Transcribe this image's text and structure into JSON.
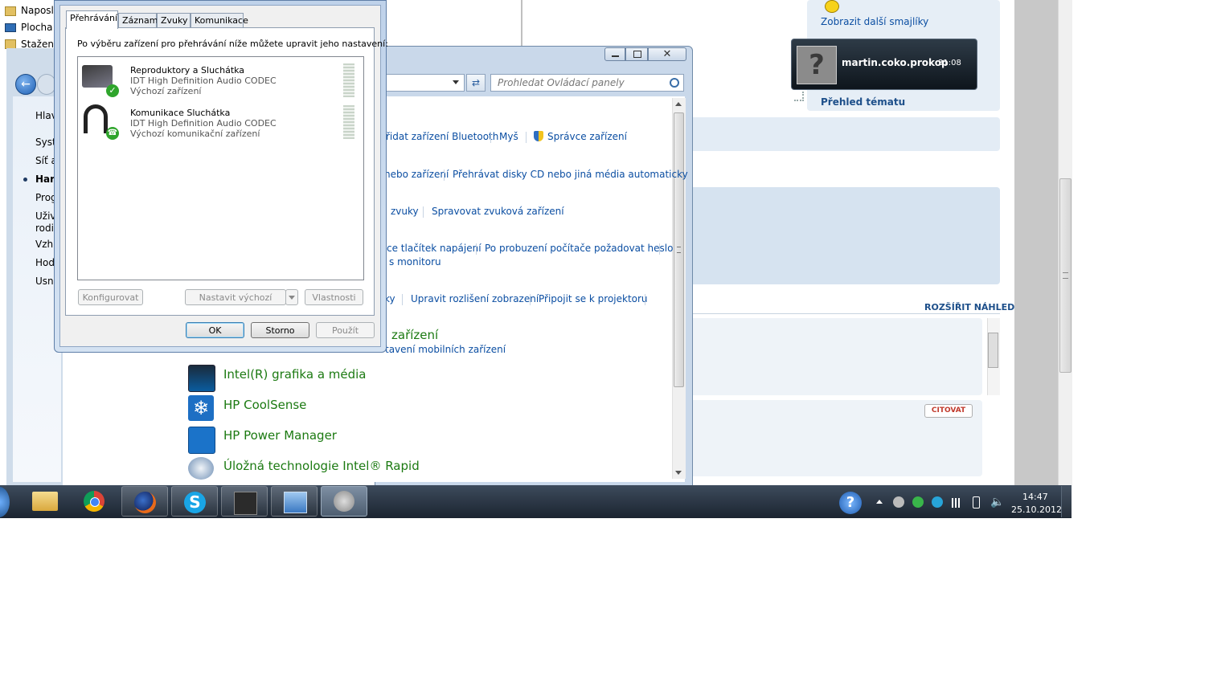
{
  "explorer": {
    "favorites": [
      "Naposle",
      "Plocha",
      "Stažené"
    ],
    "nav_items": [
      "Hlav",
      "Syst",
      "Síť a",
      "Hard",
      "Prog",
      "Uživ",
      "rodi",
      "Vzhl",
      "Hod",
      "Usna"
    ]
  },
  "browser": {
    "more_smileys": "Zobrazit další smajlíky",
    "overview": "Přehled tématu",
    "expand_preview": "ROZŠÍŘIT NÁHLED",
    "quote": "CITOVAT",
    "notification": {
      "user": "martin.coko.prokop",
      "time": "31:08"
    }
  },
  "control_panel": {
    "search_placeholder": "Prohledat Ovládací panely",
    "links": {
      "add_bluetooth": "řidat zařízení Bluetooth",
      "mouse": "Myš",
      "device_manager": "Správce zařízení",
      "device": "nebo zařízení",
      "autoplay": "Přehrávat disky CD nebo jiná média automaticky",
      "sounds": "zvuky",
      "manage_audio": "Spravovat zvuková zařízení",
      "power_buttons": "ce tlačítek napájení",
      "wake_password": "Po probuzení počítače požadovat heslo",
      "monitor": "s monitoru",
      "display_suffix": "ky",
      "resolution": "Upravit rozlišení zobrazení",
      "projector": "Připojit se k projektoru",
      "mobile_title": "zařízení",
      "mobile_settings": "tavení mobilních zařízení"
    },
    "items": [
      {
        "title": "Intel(R) grafika a média",
        "icon": "intel-graphics-icon"
      },
      {
        "title": "HP CoolSense",
        "icon": "snowflake-icon"
      },
      {
        "title": "HP Power Manager",
        "icon": "energy-star-icon"
      },
      {
        "title": "Úložná technologie Intel® Rapid",
        "icon": "storage-icon"
      }
    ]
  },
  "sound_dialog": {
    "tabs": [
      "Přehrávání",
      "Záznam",
      "Zvuky",
      "Komunikace"
    ],
    "instruction": "Po výběru zařízení pro přehrávání níže můžete upravit jeho nastavení:",
    "devices": [
      {
        "name": "Reproduktory a Sluchátka",
        "driver": "IDT High Definition Audio CODEC",
        "status": "Výchozí zařízení"
      },
      {
        "name": "Komunikace Sluchátka",
        "driver": "IDT High Definition Audio CODEC",
        "status": "Výchozí komunikační zařízení"
      }
    ],
    "buttons": {
      "configure": "Konfigurovat",
      "set_default": "Nastavit výchozí",
      "properties": "Vlastnosti",
      "ok": "OK",
      "cancel": "Storno",
      "apply": "Použít"
    }
  },
  "taskbar": {
    "clock_time": "14:47",
    "clock_date": "25.10.2012"
  },
  "colors": {
    "link": "#0b4ea2",
    "cp_title": "#1c7a12",
    "taskbar": "#1b2430"
  }
}
